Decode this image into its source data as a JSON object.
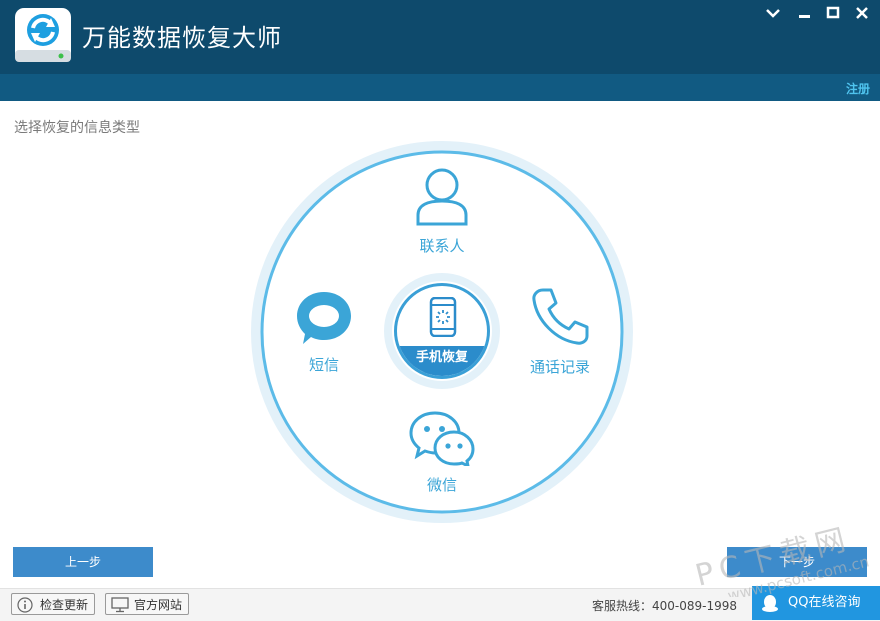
{
  "app": {
    "title": "万能数据恢复大师",
    "register_label": "注册"
  },
  "main": {
    "section_label": "选择恢复的信息类型",
    "options": {
      "contacts": "联系人",
      "sms": "短信",
      "call_log": "通话记录",
      "wechat": "微信",
      "center": "手机恢复"
    },
    "prev_button": "上一步",
    "next_button": "下一步"
  },
  "footer": {
    "check_update": "检查更新",
    "official_site": "官方网站",
    "hotline": "客服热线：400-089-1998",
    "qq_consult": "QQ在线咨询"
  },
  "watermark": {
    "text": "PC下载网",
    "url": "www.pcsoft.com.cn"
  },
  "colors": {
    "titlebar": "#0e4a6c",
    "subbar": "#115a82",
    "accent": "#3ba5d7",
    "button": "#3d8bcb",
    "qq": "#2196e0"
  },
  "icons": [
    "app-logo-icon",
    "minimize-icon",
    "maximize-icon",
    "close-icon",
    "dropdown-icon",
    "contacts-icon",
    "sms-icon",
    "phone-icon",
    "wechat-icon",
    "mobile-icon",
    "info-icon",
    "monitor-icon",
    "qq-icon"
  ]
}
